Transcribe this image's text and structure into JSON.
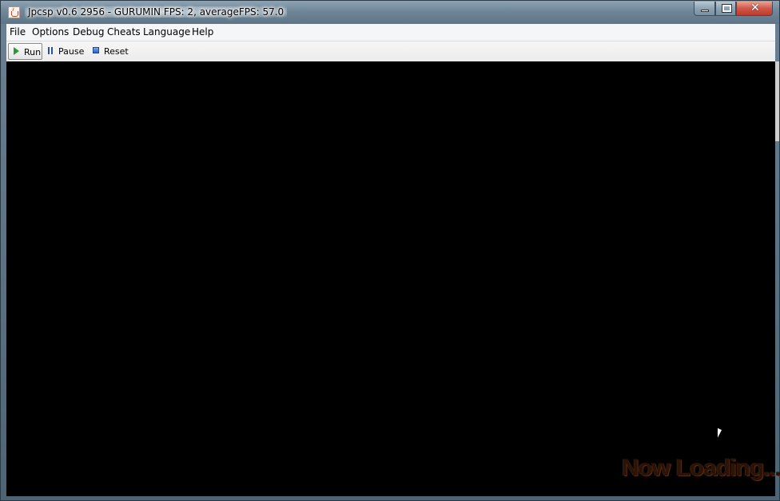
{
  "window": {
    "title": "Jpcsp v0.6 2956 - GURUMIN FPS: 2, averageFPS: 57.0",
    "app_icon": "java-cup-icon",
    "controls": {
      "minimize": "minimize-icon",
      "maximize": "maximize-icon",
      "close_glyph": "✕"
    }
  },
  "menubar": {
    "items": [
      {
        "label": "File"
      },
      {
        "label": "Options"
      },
      {
        "label": "Debug"
      },
      {
        "label": "Cheats"
      },
      {
        "label": "Language"
      },
      {
        "label": "Help"
      }
    ]
  },
  "toolbar": {
    "run_label": "Run",
    "pause_label": "Pause",
    "reset_label": "Reset"
  },
  "display": {
    "background": "#000000",
    "loading_text": "Now Loading..."
  },
  "colors": {
    "run_icon": "#2e9a2e",
    "pause_icon": "#2b4f9e",
    "reset_icon": "#2b5fc8",
    "loading_text": "#2a1408"
  }
}
